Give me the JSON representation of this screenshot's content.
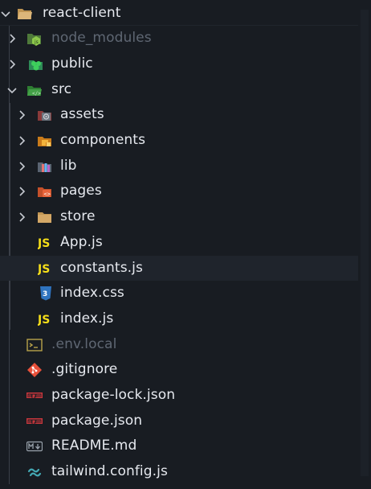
{
  "explorer": {
    "root": {
      "label": "react-client",
      "expanded": true
    },
    "items": [
      {
        "label": "node_modules",
        "icon": "node-modules-folder-icon",
        "dim": true
      },
      {
        "label": "public",
        "icon": "public-folder-icon"
      },
      {
        "label": "src",
        "icon": "src-folder-icon",
        "expanded": true
      },
      {
        "label": "assets",
        "icon": "assets-folder-icon"
      },
      {
        "label": "components",
        "icon": "components-folder-icon"
      },
      {
        "label": "lib",
        "icon": "lib-folder-icon"
      },
      {
        "label": "pages",
        "icon": "pages-folder-icon"
      },
      {
        "label": "store",
        "icon": "store-folder-icon"
      },
      {
        "label": "App.js",
        "icon": "javascript-file-icon"
      },
      {
        "label": "constants.js",
        "icon": "javascript-file-icon",
        "hovered": true
      },
      {
        "label": "index.css",
        "icon": "css-file-icon"
      },
      {
        "label": "index.js",
        "icon": "javascript-file-icon"
      },
      {
        "label": ".env.local",
        "icon": "env-file-icon",
        "dim": true
      },
      {
        "label": ".gitignore",
        "icon": "git-icon"
      },
      {
        "label": "package-lock.json",
        "icon": "npm-icon"
      },
      {
        "label": "package.json",
        "icon": "npm-icon"
      },
      {
        "label": "README.md",
        "icon": "markdown-icon"
      },
      {
        "label": "tailwind.config.js",
        "icon": "tailwind-icon"
      }
    ],
    "js_glyph": "JS",
    "colors": {
      "background": "#181c22",
      "hover": "#1f242c",
      "text": "#e6e9ef",
      "dim_text": "#5f6773",
      "js_yellow": "#f5de19",
      "css_blue": "#2f74c0",
      "git_red": "#e8503a",
      "npm_red": "#c7363c",
      "tailwind_cyan": "#44a8b3",
      "folder_tan": "#c09553"
    }
  }
}
